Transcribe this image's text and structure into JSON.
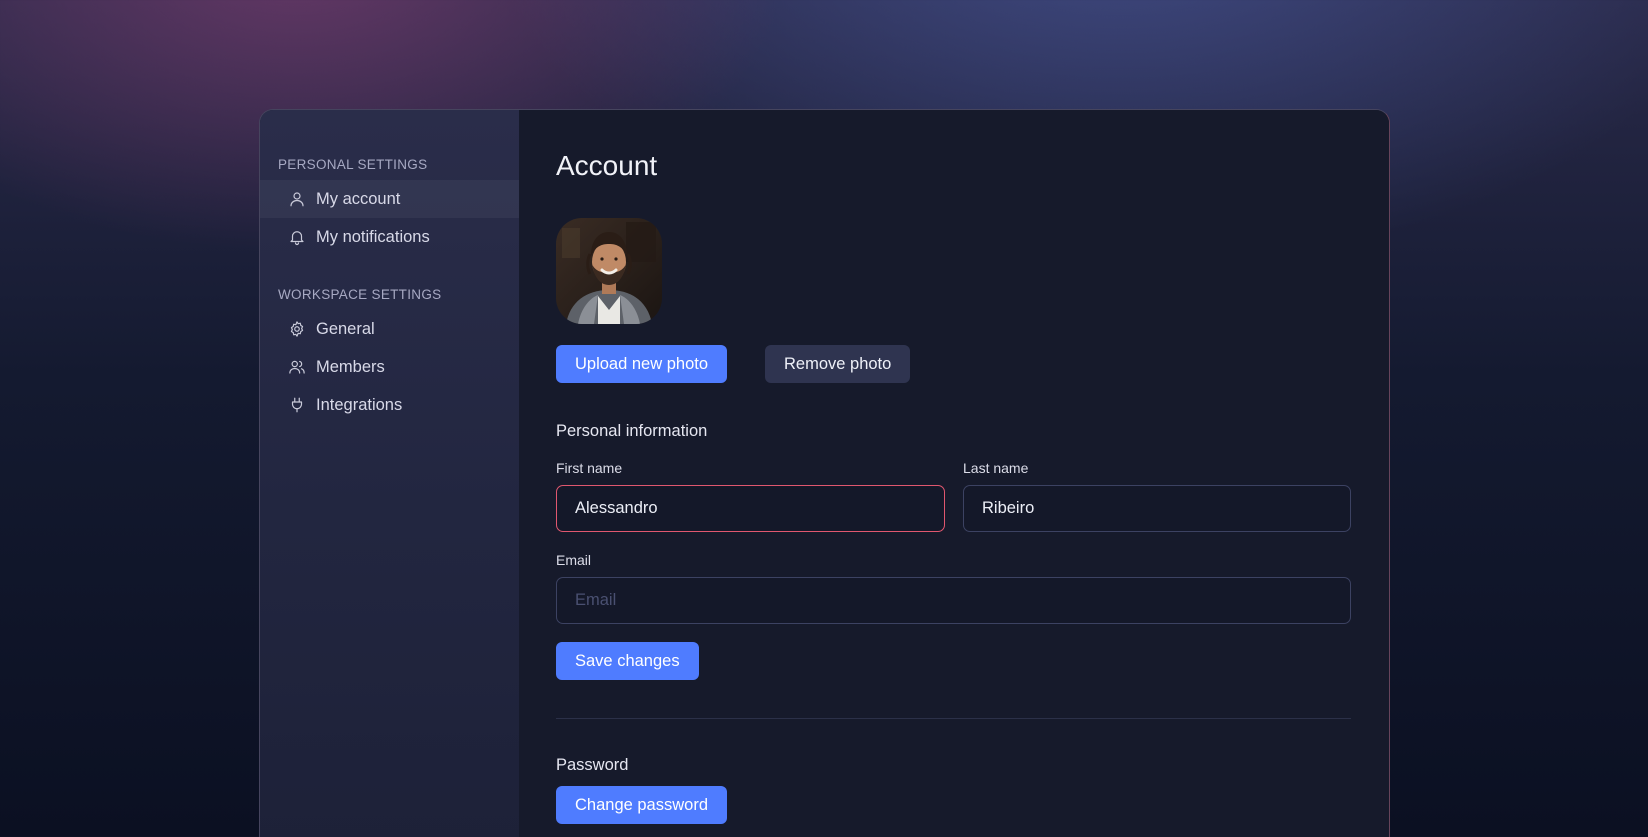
{
  "sidebar": {
    "personal_label": "PERSONAL SETTINGS",
    "personal_items": [
      {
        "label": "My account",
        "icon": "user-icon"
      },
      {
        "label": "My notifications",
        "icon": "bell-icon"
      }
    ],
    "workspace_label": "WORKSPACE SETTINGS",
    "workspace_items": [
      {
        "label": "General",
        "icon": "gear-icon"
      },
      {
        "label": "Members",
        "icon": "users-icon"
      },
      {
        "label": "Integrations",
        "icon": "plug-icon"
      }
    ]
  },
  "main": {
    "title": "Account",
    "upload_label": "Upload new photo",
    "remove_label": "Remove photo",
    "personal_info_heading": "Personal information",
    "first_name_label": "First name",
    "first_name_value": "Alessandro",
    "last_name_label": "Last name",
    "last_name_value": "Ribeiro",
    "email_label": "Email",
    "email_value": "",
    "email_placeholder": "Email",
    "save_label": "Save changes",
    "password_heading": "Password",
    "change_password_label": "Change password"
  },
  "colors": {
    "accent": "#4f7cff",
    "focus_border": "#e0576f",
    "panel": "#161a2b",
    "sidebar": "#242843"
  }
}
